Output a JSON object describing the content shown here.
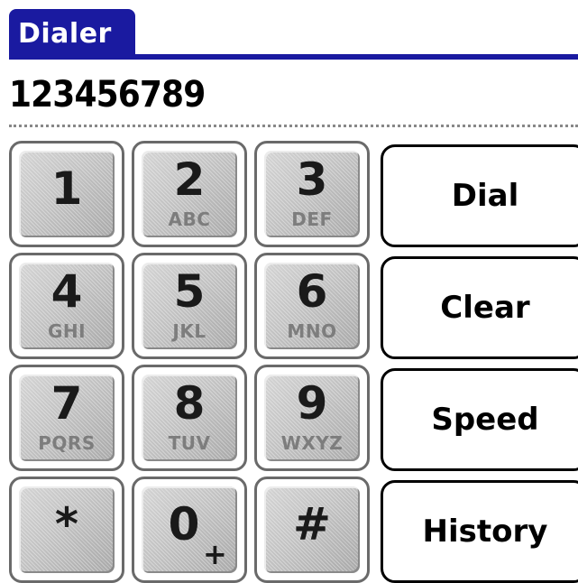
{
  "app": {
    "title": "Dialer"
  },
  "display": {
    "number": "123456789"
  },
  "keypad": {
    "keys": [
      {
        "digit": "1",
        "letters": ""
      },
      {
        "digit": "2",
        "letters": "ABC"
      },
      {
        "digit": "3",
        "letters": "DEF"
      },
      {
        "digit": "4",
        "letters": "GHI"
      },
      {
        "digit": "5",
        "letters": "JKL"
      },
      {
        "digit": "6",
        "letters": "MNO"
      },
      {
        "digit": "7",
        "letters": "PQRS"
      },
      {
        "digit": "8",
        "letters": "TUV"
      },
      {
        "digit": "9",
        "letters": "WXYZ"
      },
      {
        "digit": "*",
        "letters": ""
      },
      {
        "digit": "0",
        "letters": "+"
      },
      {
        "digit": "#",
        "letters": ""
      }
    ]
  },
  "actions": {
    "dial": "Dial",
    "clear": "Clear",
    "speed": "Speed",
    "history": "History"
  },
  "colors": {
    "title_bar": "#1a1aa0",
    "key_face": "#c2c2c2",
    "key_letters": "#7d7d7d"
  }
}
